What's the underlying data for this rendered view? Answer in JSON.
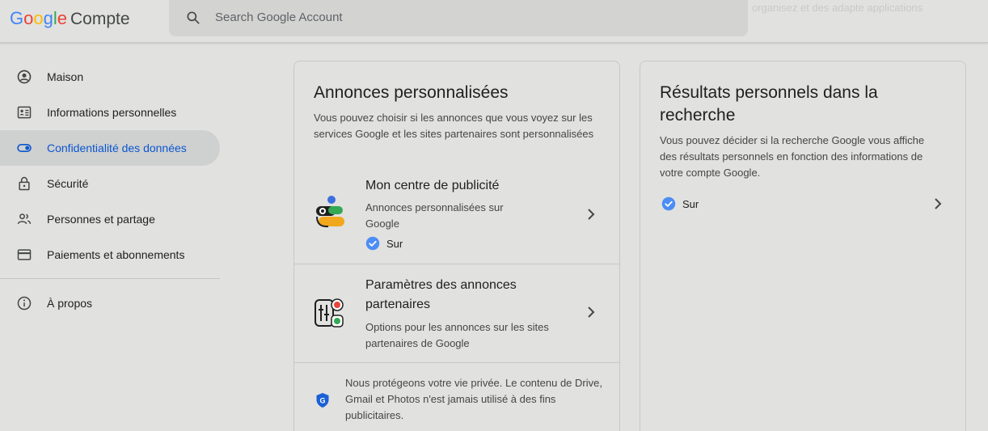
{
  "header": {
    "logo_google": "Google",
    "logo_product": "Compte",
    "search_placeholder": "Search Google Account",
    "faint_text": "organisez et des adapte applications"
  },
  "sidebar": {
    "items": [
      {
        "label": "Maison",
        "icon": "account-circle-icon",
        "active": false
      },
      {
        "label": "Informations personnelles",
        "icon": "id-card-icon",
        "active": false
      },
      {
        "label": "Confidentialité des données",
        "icon": "toggle-icon",
        "active": true
      },
      {
        "label": "Sécurité",
        "icon": "lock-icon",
        "active": false
      },
      {
        "label": "Personnes et partage",
        "icon": "people-icon",
        "active": false
      },
      {
        "label": "Paiements et abonnements",
        "icon": "credit-card-icon",
        "active": false
      }
    ],
    "about": {
      "label": "À propos",
      "icon": "info-icon"
    }
  },
  "ads_card": {
    "title": "Annonces personnalisées",
    "description": "Vous pouvez choisir si les annonces que vous voyez sur les services Google et les sites partenaires sont personnalisées",
    "rows": [
      {
        "title": "Mon centre de publicité",
        "subtitle": "Annonces personnalisées sur Google",
        "status": "Sur"
      },
      {
        "title": "Paramètres des annonces partenaires",
        "subtitle": "Options pour les annonces sur les sites partenaires de Google"
      }
    ],
    "privacy_note": "Nous protégeons votre vie privée. Le contenu de Drive, Gmail et Photos n'est jamais utilisé à des fins publicitaires."
  },
  "search_card": {
    "title": "Résultats personnels dans la recherche",
    "description": "Vous pouvez décider si la recherche Google vous affiche des résultats personnels en fonction des informations de votre compte Google.",
    "status": "Sur"
  },
  "colors": {
    "background": "#e1e1df",
    "accent_blue": "#0b57d0",
    "check_blue": "#4c8df6",
    "active_nav_bg": "#cfd0d0"
  }
}
